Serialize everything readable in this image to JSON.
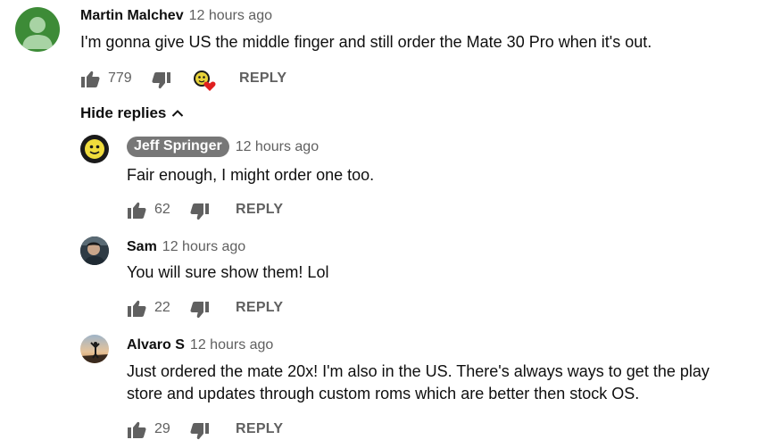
{
  "comment": {
    "author": "Martin Malchev",
    "time": "12 hours ago",
    "text": "I'm gonna give US the middle finger and still order the Mate 30 Pro when it's out.",
    "likes": "779",
    "reply_label": "REPLY",
    "creator_heart": true
  },
  "replies_toggle": {
    "label": "Hide replies"
  },
  "replies": [
    {
      "author": "Jeff Springer",
      "time": "12 hours ago",
      "text": "Fair enough, I might order one too.",
      "likes": "62",
      "reply_label": "REPLY",
      "is_creator": true
    },
    {
      "author": "Sam",
      "time": "12 hours ago",
      "text": "You will sure show them! Lol",
      "likes": "22",
      "reply_label": "REPLY"
    },
    {
      "author": "Alvaro S",
      "time": "12 hours ago",
      "text_line1": "Just ordered the mate 20x! I'm also in the US. There's always ways to get the play",
      "text_line2": "store and updates through custom roms which are better then stock OS.",
      "likes": "29",
      "reply_label": "REPLY"
    }
  ],
  "colors": {
    "text_primary": "#0f0f0f",
    "text_secondary": "#606060",
    "avatar_green": "#3d8b37",
    "creator_badge": "#777777",
    "heart": "#e01f1f"
  }
}
